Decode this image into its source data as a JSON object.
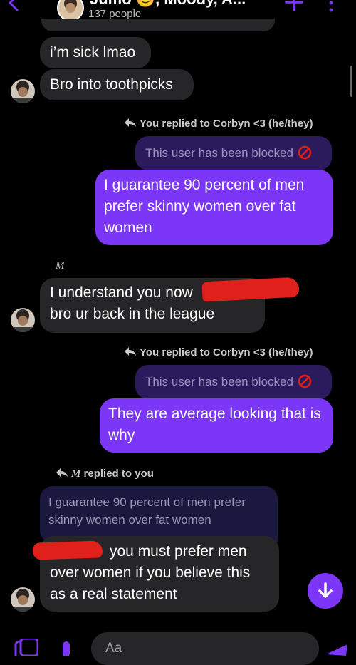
{
  "header": {
    "group_name": "Jumo 😊, Moody, A...",
    "people_count": "137 people"
  },
  "messages": {
    "m1": "i’m sick lmao",
    "m2": "Bro into toothpicks",
    "reply1_label": "You replied to Corbyn <3 (he/they)",
    "reply1_quote": "This user has been blocked",
    "m3": "I guarantee 90 percent of men prefer skinny women over fat women",
    "sender_initial": "M",
    "m4": "I understand you now",
    "m4_line2": "bro ur back in the league",
    "reply2_label": "You replied to Corbyn <3 (he/they)",
    "reply2_quote": "This user has been blocked",
    "m5": "They are average looking that is why",
    "reply3_sender": "M",
    "reply3_label": "replied to you",
    "reply3_quote": "I guarantee 90 percent of men prefer skinny women over fat women",
    "m6_line1": "you must prefer men",
    "m6_rest": "over women if you believe this as a real statement"
  },
  "composer": {
    "placeholder": "Aa"
  },
  "colors": {
    "accent": "#7b36f7",
    "incoming_bubble": "#262628",
    "redaction": "#e0201b"
  },
  "icons": [
    "back-arrow-icon",
    "plus-icon",
    "more-icon",
    "reply-arrow-icon",
    "blocked-icon",
    "arrow-down-icon",
    "gallery-icon",
    "mic-icon",
    "send-icon"
  ]
}
